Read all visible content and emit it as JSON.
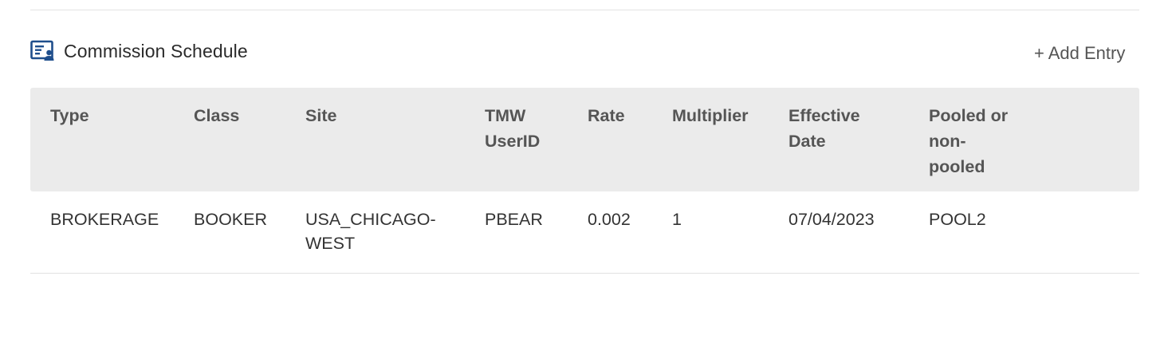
{
  "section": {
    "title": "Commission Schedule",
    "icon": "id-card-icon",
    "add_entry_label": "+ Add Entry"
  },
  "table": {
    "headers": {
      "type": "Type",
      "class": "Class",
      "site": "Site",
      "tmw_userid": "TMW UserID",
      "rate": "Rate",
      "multiplier": "Multiplier",
      "effective_date": "Effective Date",
      "pooled": "Pooled or non-pooled"
    },
    "rows": [
      {
        "type": "BROKERAGE",
        "class": "BOOKER",
        "site": "USA_CHICAGO-WEST",
        "tmw_userid": "PBEAR",
        "rate": "0.002",
        "multiplier": "1",
        "effective_date": "07/04/2023",
        "pooled": "POOL2"
      }
    ]
  },
  "colors": {
    "icon": "#1f4e8c",
    "header_bg": "#ebebeb",
    "divider": "#e1e1e1"
  }
}
